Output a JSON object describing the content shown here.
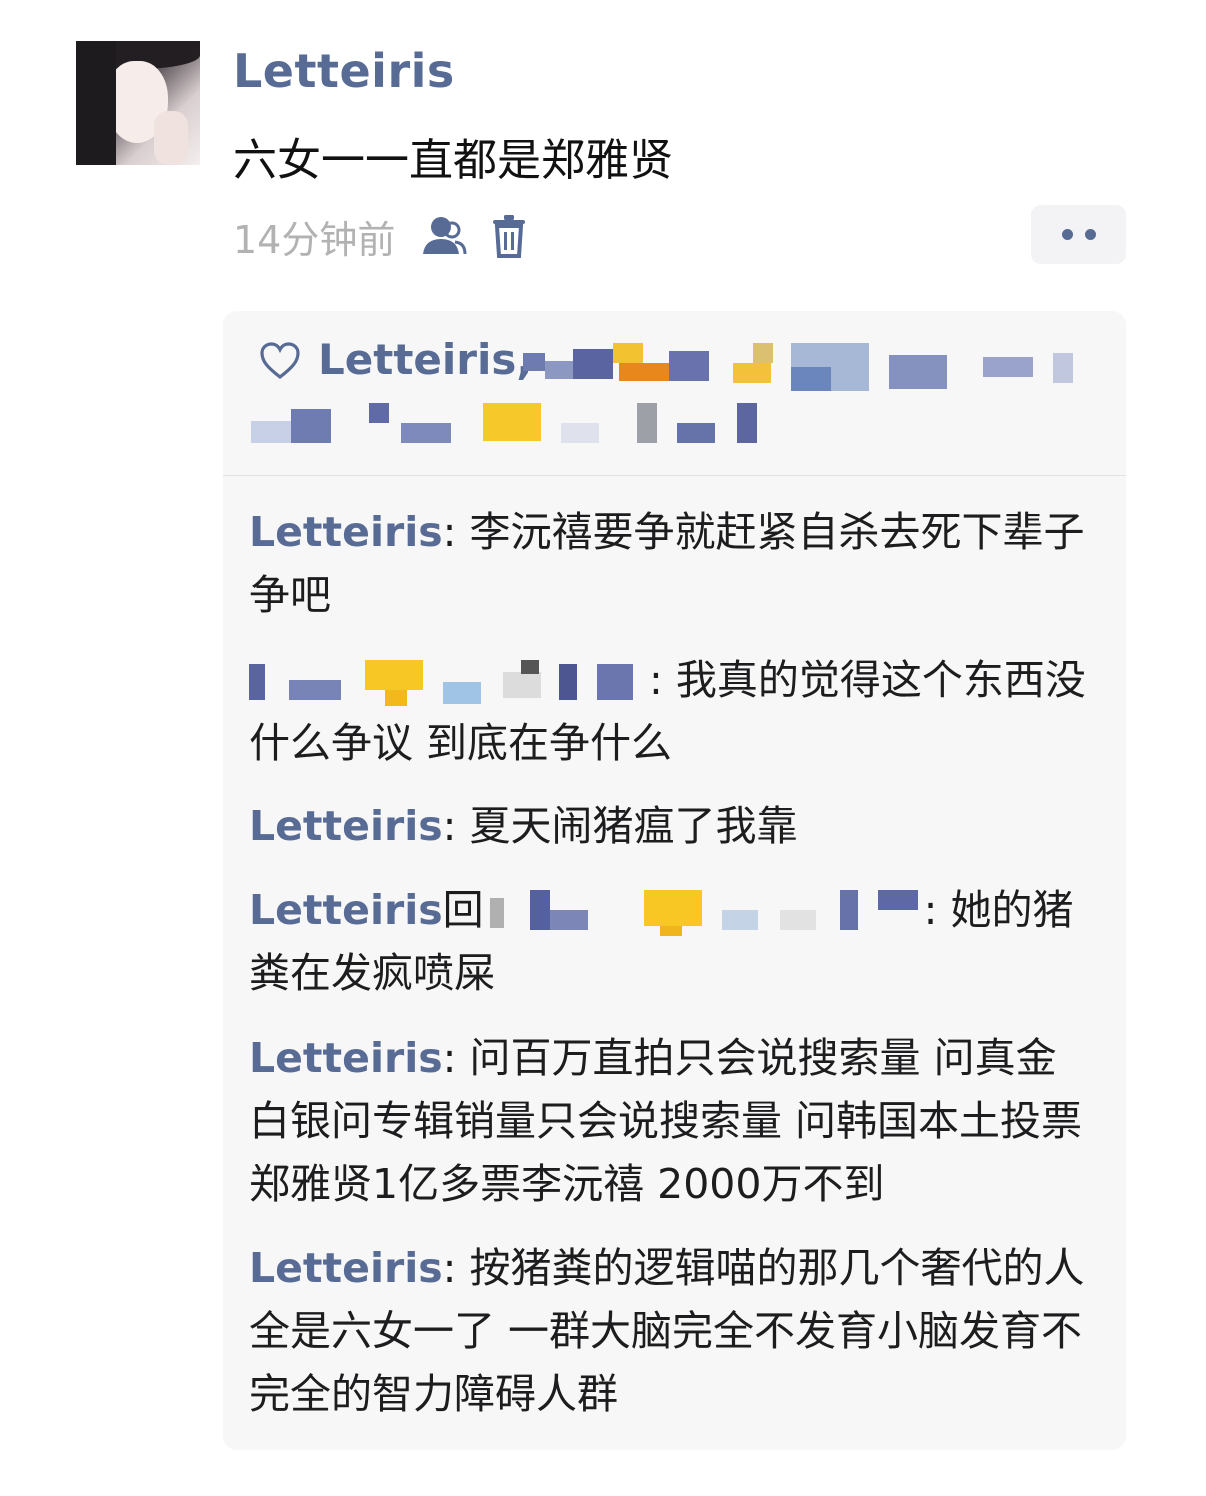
{
  "post": {
    "username": "Letteiris",
    "text": "六女一一直都是郑雅贤",
    "time": "14分钟前",
    "icons": {
      "visibility": "person-icon",
      "delete": "trash-icon",
      "more": "more-dots-icon",
      "like": "heart-icon"
    },
    "colors": {
      "name": "#576b95",
      "panel": "#f7f7f7",
      "time": "#b2b2b2"
    }
  },
  "likes": {
    "first_name": "Letteiris,"
  },
  "comments": [
    {
      "author": "Letteiris",
      "sep": ": ",
      "text": "李沅禧要争就赶紧自杀去死下辈子争吧"
    },
    {
      "author": "",
      "sep": ": ",
      "text": "我真的觉得这个东西没什么争议 到底在争什么"
    },
    {
      "author": "Letteiris",
      "sep": ": ",
      "text": "夏天闹猪瘟了我靠"
    },
    {
      "author": "Letteiris",
      "reply": "回",
      "sep": ": ",
      "text": "她的猪粪在发疯喷屎"
    },
    {
      "author": "Letteiris",
      "sep": ": ",
      "text": "问百万直拍只会说搜索量 问真金白银问专辑销量只会说搜索量 问韩国本土投票郑雅贤1亿多票李沅禧 2000万不到"
    },
    {
      "author": "Letteiris",
      "sep": ": ",
      "text": "按猪粪的逻辑喵的那几个奢代的人全是六女一了 一群大脑完全不发育小脑发育不完全的智力障碍人群"
    }
  ]
}
